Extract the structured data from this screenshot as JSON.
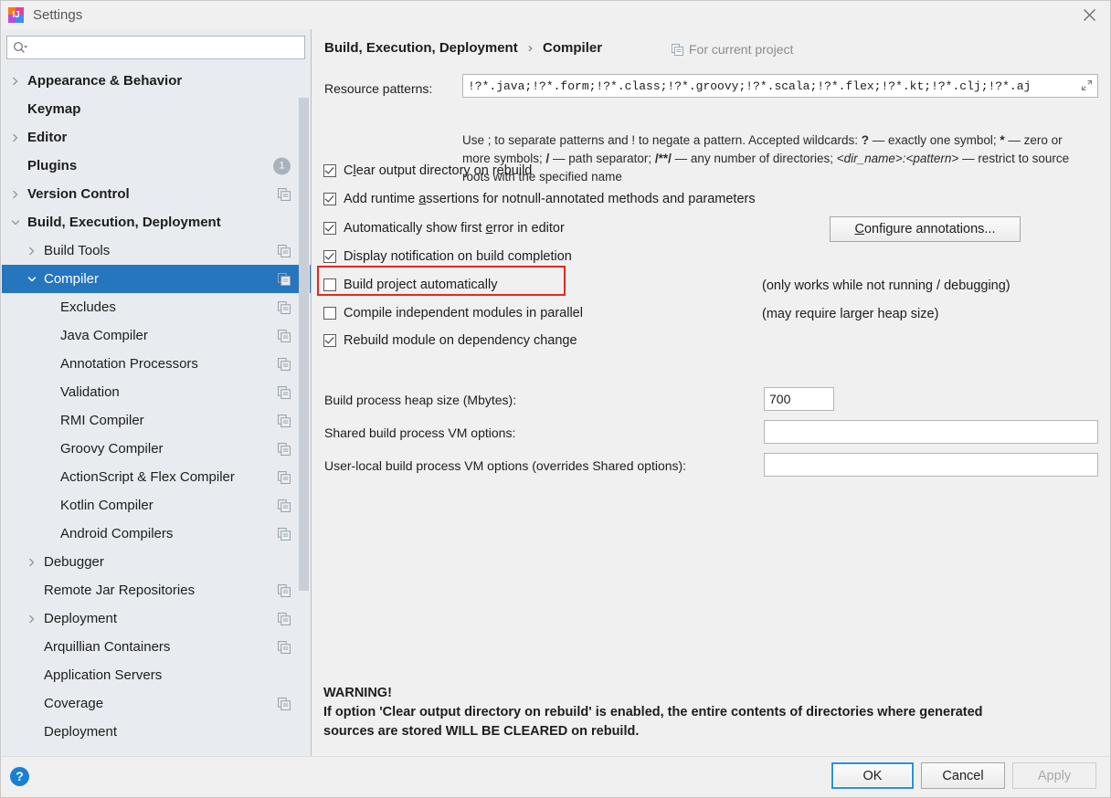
{
  "window": {
    "title": "Settings",
    "app_icon": "intellij-idea-icon",
    "close_label": "✕"
  },
  "sidebar": {
    "search": {
      "placeholder": "",
      "value": "",
      "icon": "search-icon"
    },
    "items": [
      {
        "label": "Appearance & Behavior",
        "indent": 0,
        "arrow": "right",
        "bold": true,
        "copy": false
      },
      {
        "label": "Keymap",
        "indent": 0,
        "arrow": "none",
        "bold": true,
        "copy": false
      },
      {
        "label": "Editor",
        "indent": 0,
        "arrow": "right",
        "bold": true,
        "copy": false
      },
      {
        "label": "Plugins",
        "indent": 0,
        "arrow": "none",
        "bold": true,
        "copy": false,
        "badge": "1"
      },
      {
        "label": "Version Control",
        "indent": 0,
        "arrow": "right",
        "bold": true,
        "copy": true
      },
      {
        "label": "Build, Execution, Deployment",
        "indent": 0,
        "arrow": "down",
        "bold": true,
        "copy": false
      },
      {
        "label": "Build Tools",
        "indent": 1,
        "arrow": "right",
        "bold": false,
        "copy": true
      },
      {
        "label": "Compiler",
        "indent": 1,
        "arrow": "down",
        "bold": false,
        "copy": true,
        "selected": true
      },
      {
        "label": "Excludes",
        "indent": 2,
        "arrow": "none",
        "bold": false,
        "copy": true
      },
      {
        "label": "Java Compiler",
        "indent": 2,
        "arrow": "none",
        "bold": false,
        "copy": true
      },
      {
        "label": "Annotation Processors",
        "indent": 2,
        "arrow": "none",
        "bold": false,
        "copy": true
      },
      {
        "label": "Validation",
        "indent": 2,
        "arrow": "none",
        "bold": false,
        "copy": true
      },
      {
        "label": "RMI Compiler",
        "indent": 2,
        "arrow": "none",
        "bold": false,
        "copy": true
      },
      {
        "label": "Groovy Compiler",
        "indent": 2,
        "arrow": "none",
        "bold": false,
        "copy": true
      },
      {
        "label": "ActionScript & Flex Compiler",
        "indent": 2,
        "arrow": "none",
        "bold": false,
        "copy": true
      },
      {
        "label": "Kotlin Compiler",
        "indent": 2,
        "arrow": "none",
        "bold": false,
        "copy": true
      },
      {
        "label": "Android Compilers",
        "indent": 2,
        "arrow": "none",
        "bold": false,
        "copy": true
      },
      {
        "label": "Debugger",
        "indent": 1,
        "arrow": "right",
        "bold": false,
        "copy": false
      },
      {
        "label": "Remote Jar Repositories",
        "indent": 1,
        "arrow": "none",
        "bold": false,
        "copy": true
      },
      {
        "label": "Deployment",
        "indent": 1,
        "arrow": "right",
        "bold": false,
        "copy": true
      },
      {
        "label": "Arquillian Containers",
        "indent": 1,
        "arrow": "none",
        "bold": false,
        "copy": true
      },
      {
        "label": "Application Servers",
        "indent": 1,
        "arrow": "none",
        "bold": false,
        "copy": false
      },
      {
        "label": "Coverage",
        "indent": 1,
        "arrow": "none",
        "bold": false,
        "copy": true
      },
      {
        "label": "Deployment",
        "indent": 1,
        "arrow": "none",
        "bold": false,
        "copy": false
      }
    ]
  },
  "main": {
    "breadcrumb": {
      "parent": "Build, Execution, Deployment",
      "separator": "›",
      "current": "Compiler"
    },
    "for_current_project": {
      "label": "For current project",
      "icon": "copy-icon"
    },
    "resource_patterns": {
      "label": "Resource patterns:",
      "value": "!?*.java;!?*.form;!?*.class;!?*.groovy;!?*.scala;!?*.flex;!?*.kt;!?*.clj;!?*.aj",
      "expand_icon": "expand-icon"
    },
    "hint": {
      "part1": "Use ; to separate patterns and ! to negate a pattern. Accepted wildcards: ",
      "b1": "?",
      "part2": " — exactly one symbol; ",
      "b2": "*",
      "part3": " — zero or more symbols; ",
      "b3": "/",
      "part4": " — path separator; ",
      "b4": "/**/",
      "part5": " — any number of directories;  ",
      "i1": "<dir_name>:<pattern>",
      "part6": " — restrict to source roots with the specified name"
    },
    "checkboxes": [
      {
        "label_pre": "C",
        "label_mn": "l",
        "label_post": "ear output directory on rebuild",
        "checked": true
      },
      {
        "label_pre": "Add runtime ",
        "label_mn": "a",
        "label_post": "ssertions for notnull-annotated methods and parameters",
        "checked": true
      },
      {
        "label_pre": "Automatically show first ",
        "label_mn": "e",
        "label_post": "rror in editor",
        "checked": true
      },
      {
        "label_pre": "Display notification on build completion",
        "label_mn": "",
        "label_post": "",
        "checked": true
      },
      {
        "label_pre": "Build project automatically",
        "label_mn": "",
        "label_post": "",
        "checked": false,
        "highlighted": true,
        "note": "(only works while not running / debugging)"
      },
      {
        "label_pre": "Compile independent modules in parallel",
        "label_mn": "",
        "label_post": "",
        "checked": false,
        "note": "(may require larger heap size)"
      },
      {
        "label_pre": "Rebuild module on dependency change",
        "label_mn": "",
        "label_post": "",
        "checked": true
      }
    ],
    "configure_annotations": {
      "pre": "",
      "mn": "C",
      "post": "onfigure annotations..."
    },
    "fields": [
      {
        "label": "Build process heap size (Mbytes):",
        "value": "700",
        "placeholder": ""
      },
      {
        "label": "Shared build process VM options:",
        "value": "",
        "placeholder": ""
      },
      {
        "label": "User-local build process VM options (overrides Shared options):",
        "value": "",
        "placeholder": ""
      }
    ],
    "warning": {
      "title": "WARNING!",
      "line1": "If option 'Clear output directory on rebuild' is enabled, the entire contents of directories where generated",
      "line2": "sources are stored WILL BE CLEARED on rebuild."
    }
  },
  "footer": {
    "help": "?",
    "ok": "OK",
    "cancel": "Cancel",
    "apply": "Apply"
  },
  "colors": {
    "selection": "#2675bf",
    "highlight": "#e8261c",
    "accent": "#1a7fd4",
    "sidebar_bg": "#e8ecf0",
    "panel_bg": "#f0f0f0"
  }
}
